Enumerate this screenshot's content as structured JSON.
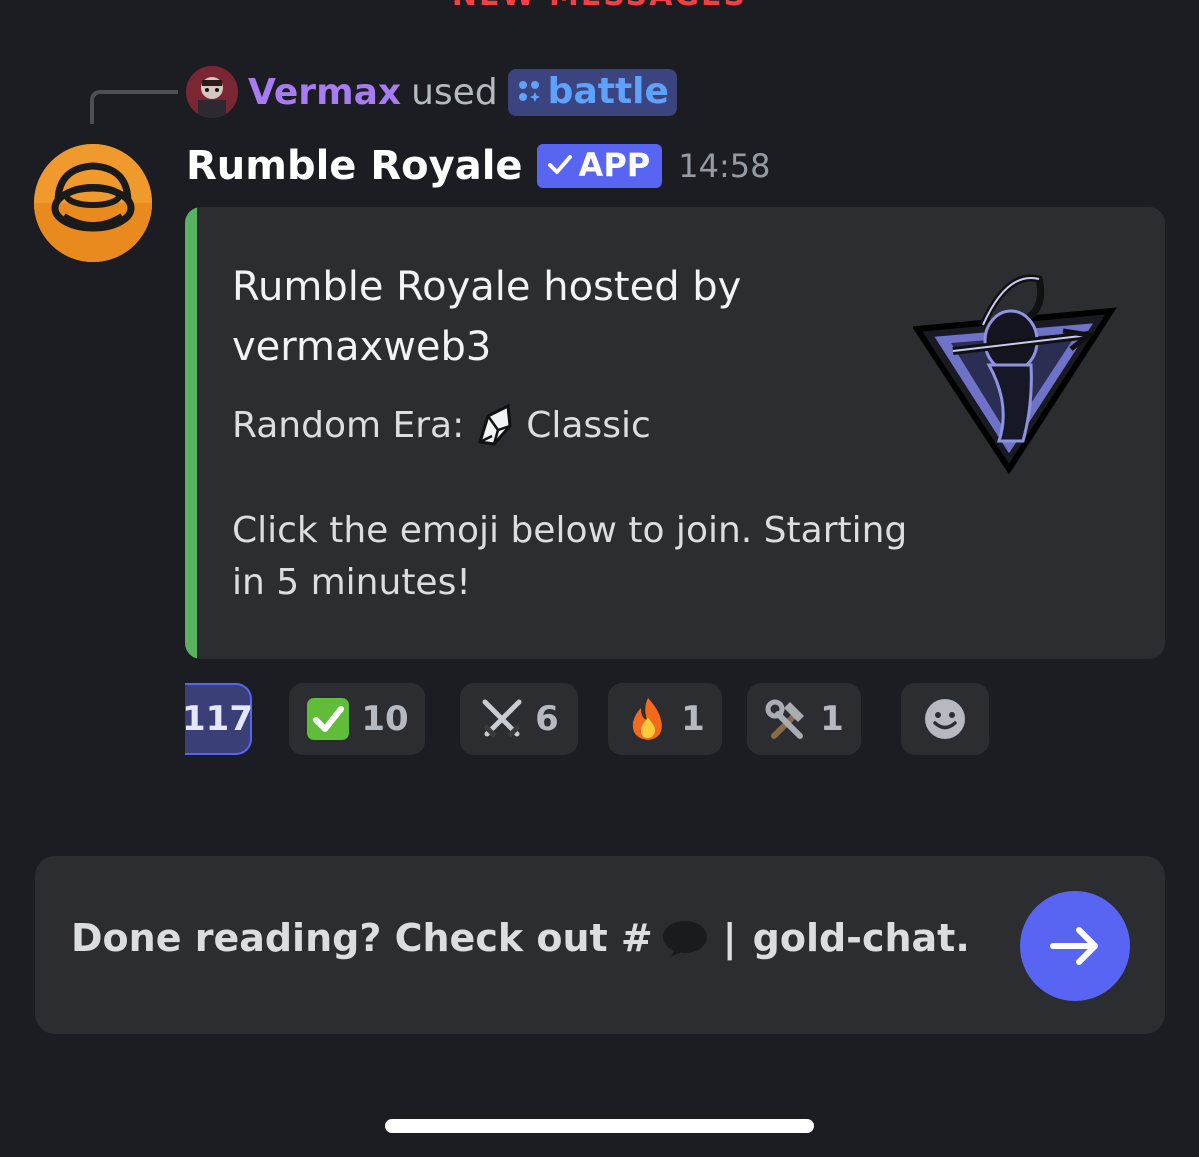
{
  "divider": {
    "label": "NEW MESSAGES"
  },
  "interaction": {
    "user": "Vermax",
    "verb": "used",
    "command": "battle"
  },
  "message": {
    "author": "Rumble Royale",
    "tag": "APP",
    "timestamp": "14:58"
  },
  "embed": {
    "accent_color": "#57b35f",
    "title": "Rumble Royale hosted by vermaxweb3",
    "era_label": "Random Era:",
    "era_value": "Classic",
    "description": "Click the emoji below to join. Starting in 5 minutes!"
  },
  "reactions": [
    {
      "emoji": "",
      "count": "117",
      "me": true
    },
    {
      "emoji": "check-mark-button-icon",
      "count": "10"
    },
    {
      "emoji": "crossed-swords-icon",
      "count": "6"
    },
    {
      "emoji": "fire-icon",
      "count": "1"
    },
    {
      "emoji": "hammer-and-wrench-icon",
      "count": "1"
    },
    {
      "emoji": "add-reaction-icon",
      "count": ""
    }
  ],
  "read_prompt": {
    "lead": "Done reading? Check out #",
    "channel": "gold-chat.",
    "separator": "|"
  },
  "colors": {
    "blurple": "#5865f2",
    "background": "#1c1d22",
    "card": "#2b2d31"
  }
}
